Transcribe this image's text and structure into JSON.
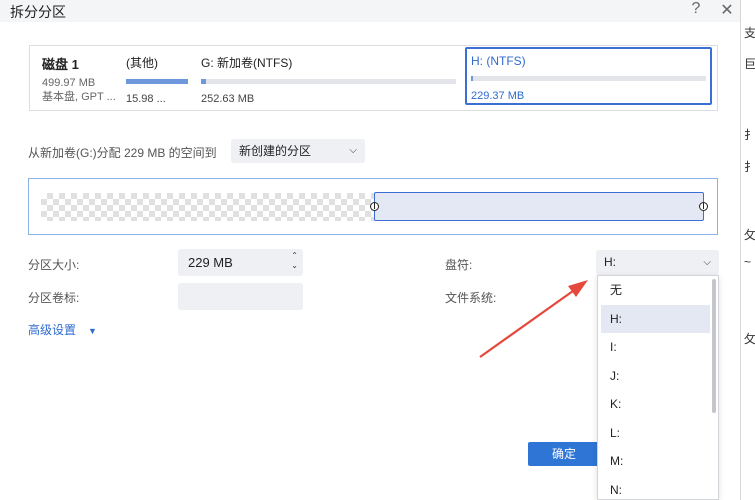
{
  "window": {
    "title": "拆分分区",
    "help": "?",
    "close": "✕"
  },
  "disk": {
    "name": "磁盘 1",
    "size": "499.97 MB",
    "type": "基本盘, GPT ..."
  },
  "partitions": [
    {
      "label": "(其他)",
      "size": "15.98 ...",
      "fill_percent": 100
    },
    {
      "label": "G: 新加卷(NTFS)",
      "size": "252.63 MB",
      "fill_percent": 2
    },
    {
      "label": "H: (NTFS)",
      "size": "229.37 MB",
      "fill_percent": 1,
      "selected": true
    }
  ],
  "allocate": {
    "label": "从新加卷(G:)分配 229 MB 的空间到",
    "target": "新创建的分区"
  },
  "form": {
    "size_label": "分区大小:",
    "size_value": "229 MB",
    "volume_label": "分区卷标:",
    "volume_value": "",
    "letter_label": "盘符:",
    "letter_value": "H:",
    "fs_label": "文件系统:",
    "advanced": "高级设置"
  },
  "buttons": {
    "ok": "确定"
  },
  "dropdown": {
    "options": [
      "无",
      "H:",
      "I:",
      "J:",
      "K:",
      "L:",
      "M:",
      "N:"
    ],
    "selected": "H:"
  },
  "side_strip": [
    "支",
    "巨",
    "扌",
    "扌",
    "攵",
    "~",
    "攵"
  ],
  "colors": {
    "accent": "#2f75d6",
    "selection_border": "#3b6fd5",
    "annotation_arrow": "#e5483c"
  }
}
